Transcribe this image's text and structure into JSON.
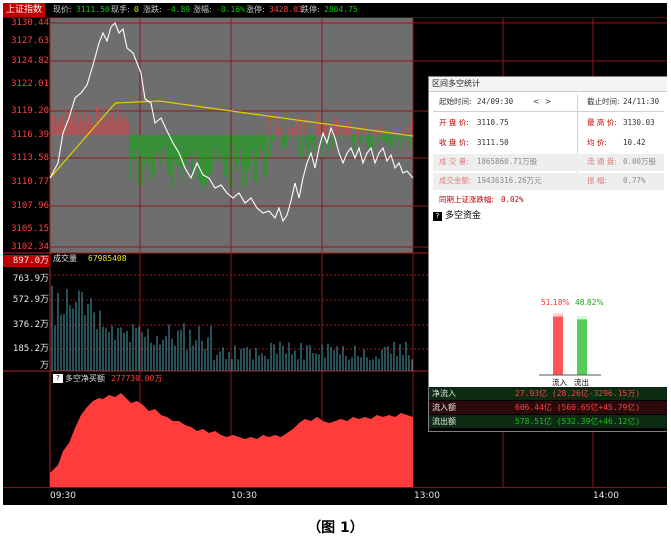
{
  "topbar": {
    "index_name": "上证指数",
    "price_label": "现价:",
    "price": "3111.50",
    "volume_label": "现手:",
    "volume": "0",
    "change_label": "涨跌:",
    "change": "-4.89",
    "pct_label": "涨幅:",
    "pct": "-0.16%",
    "up_label": "涨停:",
    "up": "3428.03",
    "down_label": "跌停:",
    "down": "2804.75"
  },
  "price_axis": [
    "3130.44",
    "3127.63",
    "3124.82",
    "3122.01",
    "3119.20",
    "3116.39",
    "3113.58",
    "3110.77",
    "3107.96",
    "3105.15",
    "3102.34"
  ],
  "volume_panel": {
    "label": "成交量",
    "value": "67985408",
    "axis": [
      "897.0万",
      "763.9万",
      "572.9万",
      "376.2万",
      "185.2万",
      "万"
    ]
  },
  "netflow_panel": {
    "label": "多空净买额",
    "value": "277730.00万"
  },
  "time_axis": [
    "09:30",
    "10:30",
    "13:00",
    "14:00"
  ],
  "interval_panel": {
    "title": "区间多空统计",
    "start_label": "起始时间:",
    "start": "24/09:30",
    "nav_prev": "<",
    "nav_next": ">",
    "end_label": "截止时间:",
    "end": "24/11:30",
    "open_label": "开 盘 价:",
    "open": "3110.75",
    "high_label": "最 高 价:",
    "high": "3130.03",
    "close_label": "收 盘 价:",
    "close": "3111.50",
    "avg_label": "均    价:",
    "avg": "10.42",
    "volume_label": "成 交 量:",
    "volume": "1865860.71万股",
    "float_label": "流 通 盘:",
    "float": "0.00万股",
    "amount_label": "成交金额:",
    "amount": "19436316.26万元",
    "amplitude_label": "振    幅:",
    "amplitude": "0.77%",
    "same_period_label": "同期上证涨跌幅:",
    "same_period": "0.02%"
  },
  "capital": {
    "help": "?",
    "title": "多空资金",
    "inflow_pct": "51.18%",
    "outflow_pct": "48.82%",
    "inflow_label": "流入",
    "outflow_label": "流出"
  },
  "flow_rows": [
    {
      "label": "净流入",
      "value": "27.93亿 (28.26亿-3296.15万)"
    },
    {
      "label": "流入额",
      "value": "606.44亿 (560.65亿+45.79亿)"
    },
    {
      "label": "流出额",
      "value": "578.51亿 (532.39亿+46.12亿)"
    }
  ],
  "caption": "（图 1）",
  "colors": {
    "up": "#ff3c3c",
    "down": "#00c000",
    "avg_line": "#e0d000",
    "price_line": "#ffffff",
    "grid": "#8b1a1a"
  }
}
